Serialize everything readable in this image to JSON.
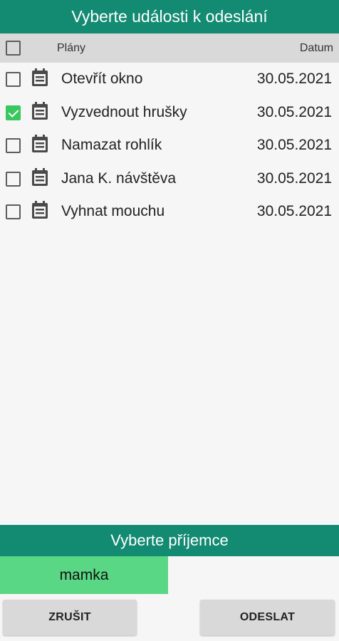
{
  "header": {
    "title": "Vyberte události k odeslání"
  },
  "columns": {
    "plans": "Plány",
    "date": "Datum"
  },
  "events": [
    {
      "title": "Otevřít okno",
      "date": "30.05.2021",
      "checked": false
    },
    {
      "title": "Vyzvednout hrušky",
      "date": "30.05.2021",
      "checked": true
    },
    {
      "title": "Namazat rohlík",
      "date": "30.05.2021",
      "checked": false
    },
    {
      "title": "Jana K. návštěva",
      "date": "30.05.2021",
      "checked": false
    },
    {
      "title": "Vyhnat mouchu",
      "date": "30.05.2021",
      "checked": false
    }
  ],
  "recipients": {
    "title": "Vyberte příjemce",
    "selected": "mamka"
  },
  "actions": {
    "cancel": "ZRUŠIT",
    "send": "ODESLAT"
  },
  "colors": {
    "accent": "#138a72",
    "selected": "#5ad784",
    "check": "#39c75f"
  }
}
